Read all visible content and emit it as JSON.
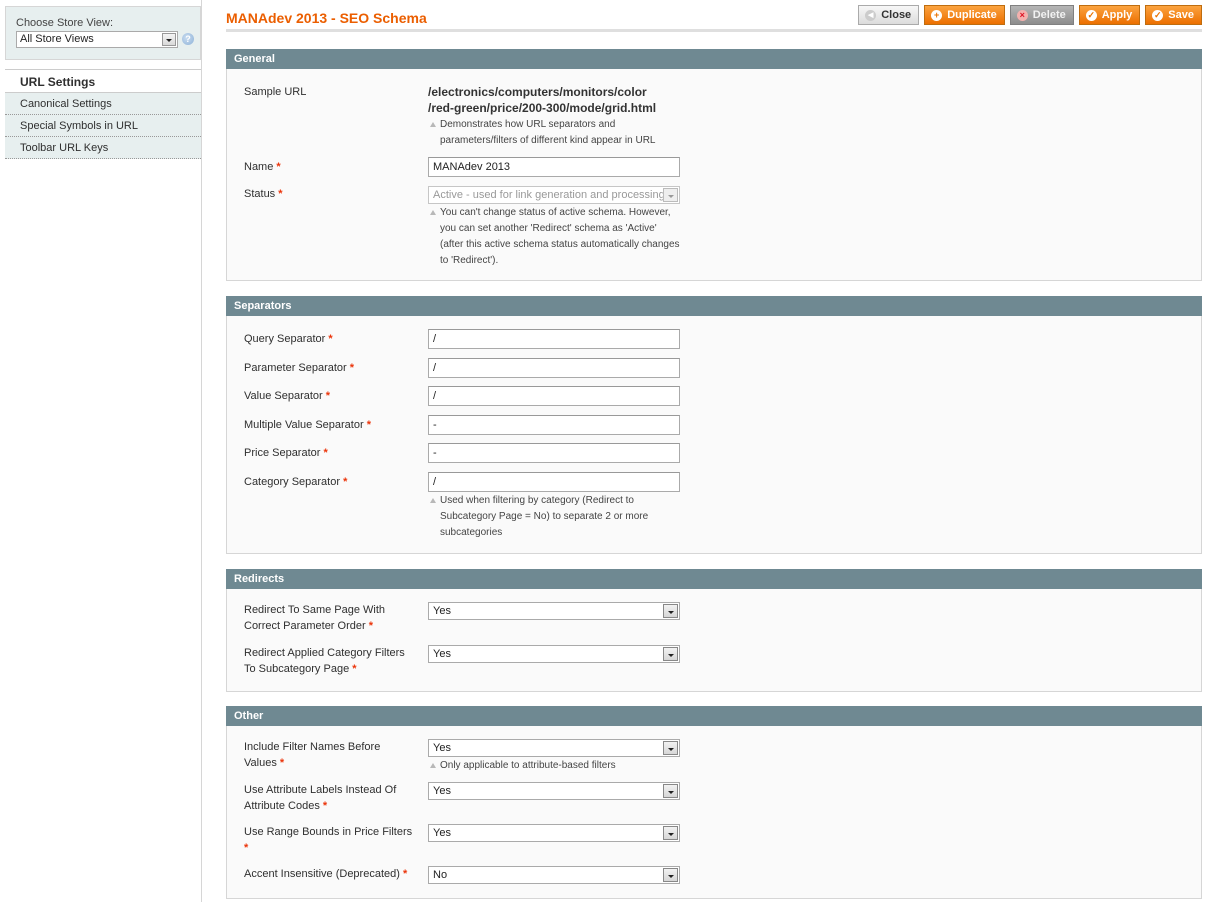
{
  "sidebar": {
    "store_switcher_label": "Choose Store View:",
    "store_view_value": "All Store Views",
    "tabs": [
      {
        "label": "URL Settings",
        "active": true
      },
      {
        "label": "Canonical Settings",
        "active": false
      },
      {
        "label": "Special Symbols in URL",
        "active": false
      },
      {
        "label": "Toolbar URL Keys",
        "active": false
      }
    ]
  },
  "header": {
    "title": "MANAdev 2013 - SEO Schema",
    "buttons": {
      "close": "Close",
      "duplicate": "Duplicate",
      "delete": "Delete",
      "apply": "Apply",
      "save": "Save"
    }
  },
  "required_mark": "*",
  "general": {
    "title": "General",
    "sample_url_label": "Sample URL",
    "sample_url_line1": "/electronics/computers/monitors/color",
    "sample_url_line2": "/red-green/price/200-300/mode/grid.html",
    "sample_url_note": "Demonstrates how URL separators and parameters/filters of different kind appear in URL",
    "name_label": "Name",
    "name_value": "MANAdev 2013",
    "status_label": "Status",
    "status_value": "Active - used for link generation and processing",
    "status_note": "You can't change status of active schema. However, you can set another 'Redirect' schema as 'Active' (after this active schema status automatically changes to 'Redirect')."
  },
  "separators": {
    "title": "Separators",
    "fields": [
      {
        "label": "Query Separator",
        "value": "/"
      },
      {
        "label": "Parameter Separator",
        "value": "/"
      },
      {
        "label": "Value Separator",
        "value": "/"
      },
      {
        "label": "Multiple Value Separator",
        "value": "-"
      },
      {
        "label": "Price Separator",
        "value": "-"
      },
      {
        "label": "Category Separator",
        "value": "/"
      }
    ],
    "category_note": "Used when filtering by category (Redirect to Subcategory Page = No) to separate 2 or more subcategories"
  },
  "redirects": {
    "title": "Redirects",
    "fields": [
      {
        "label": "Redirect To Same Page With Correct Parameter Order",
        "value": "Yes"
      },
      {
        "label": "Redirect Applied Category Filters To Subcategory Page",
        "value": "Yes"
      }
    ]
  },
  "other": {
    "title": "Other",
    "fields": [
      {
        "label": "Include Filter Names Before Values",
        "value": "Yes",
        "note": "Only applicable to attribute-based filters"
      },
      {
        "label": "Use Attribute Labels Instead Of Attribute Codes",
        "value": "Yes"
      },
      {
        "label": "Use Range Bounds in Price Filters",
        "value": "Yes"
      },
      {
        "label": "Accent Insensitive (Deprecated)",
        "value": "No"
      }
    ]
  }
}
